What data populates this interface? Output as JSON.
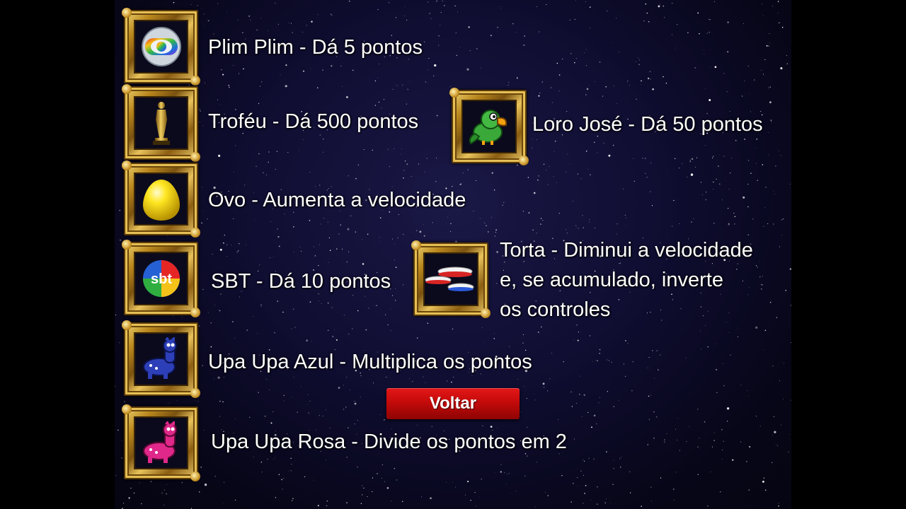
{
  "items": [
    {
      "icon": "plim-plim-icon",
      "label": "Plim Plim - Dá 5 pontos"
    },
    {
      "icon": "trophy-icon",
      "label": "Troféu - Dá 500 pontos"
    },
    {
      "icon": "parrot-icon",
      "label": "Loro José - Dá 50 pontos"
    },
    {
      "icon": "egg-icon",
      "label": "Ovo - Aumenta a velocidade"
    },
    {
      "icon": "sbt-logo-icon",
      "label": "SBT - Dá 10 pontos"
    },
    {
      "icon": "pie-icon",
      "lines": [
        "Torta - Diminui a velocidade",
        "e, se acumulado, inverte",
        "os controles"
      ]
    },
    {
      "icon": "blue-upa-upa-icon",
      "label": "Upa Upa Azul - Multiplica os pontos"
    },
    {
      "icon": "pink-upa-upa-icon",
      "label": "Upa Upa Rosa - Divide os pontos em 2"
    }
  ],
  "back_button": {
    "label": "Voltar"
  },
  "colors": {
    "button": "#c40a0a",
    "frame_gold": "#d4a73a",
    "text": "#ffffff",
    "sky": "#0f0d30"
  }
}
